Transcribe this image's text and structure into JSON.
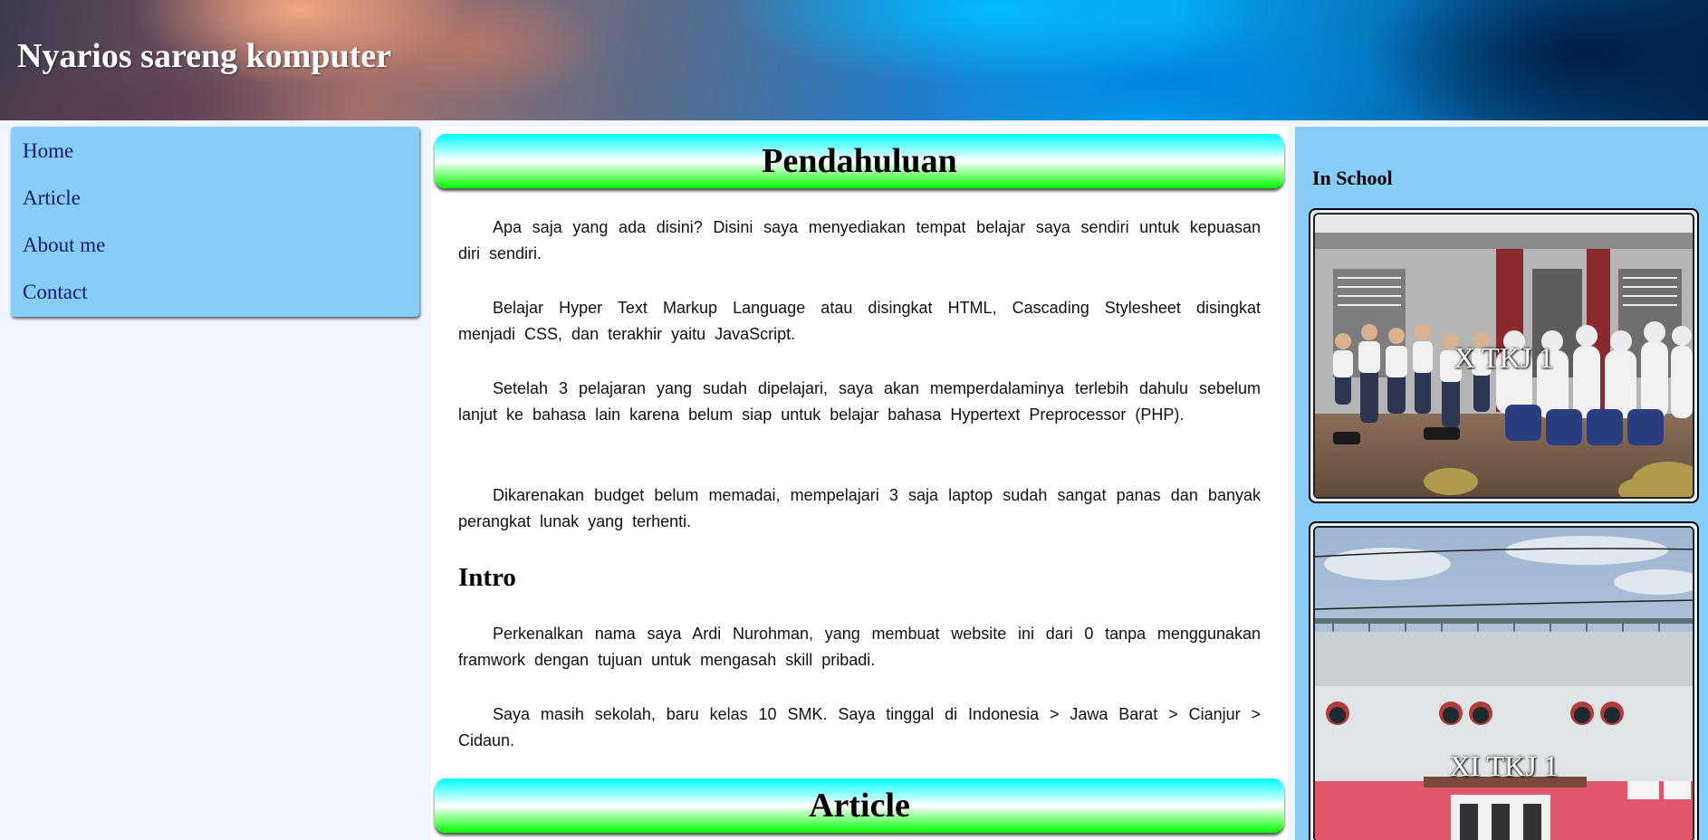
{
  "header": {
    "title": "Nyarios sareng komputer"
  },
  "nav": {
    "items": [
      {
        "label": "Home"
      },
      {
        "label": "Article"
      },
      {
        "label": "About me"
      },
      {
        "label": "Contact"
      }
    ]
  },
  "main": {
    "section1_title": "Pendahuluan",
    "paragraphs": [
      "Apa saja yang ada disini? Disini saya menyediakan tempat belajar saya sendiri untuk kepuasan diri sendiri.",
      "Belajar Hyper Text Markup Language atau disingkat HTML, Cascading Stylesheet disingkat menjadi CSS, dan terakhir yaitu JavaScript.",
      "Setelah 3 pelajaran yang sudah dipelajari, saya akan memperdalaminya terlebih dahulu sebelum lanjut ke bahasa lain karena belum siap untuk belajar bahasa Hypertext Preprocessor (PHP).",
      "Dikarenakan budget belum memadai, mempelajari 3 saja laptop sudah sangat panas dan banyak perangkat lunak yang terhenti."
    ],
    "intro_title": "Intro",
    "intro_paragraphs": [
      "Perkenalkan nama saya Ardi Nurohman, yang membuat website ini dari 0 tanpa menggunakan framwork dengan tujuan untuk mengasah skill pribadi.",
      "Saya masih sekolah, baru kelas 10 SMK. Saya tinggal di Indonesia > Jawa Barat > Cianjur > Cidaun."
    ],
    "section2_title": "Article"
  },
  "aside": {
    "title": "In School",
    "photos": [
      {
        "caption": "X TKJ 1"
      },
      {
        "caption": "XI TKJ 1"
      }
    ]
  },
  "colors": {
    "nav_bg": "#87cdf7",
    "nav_text": "#0b1a73",
    "aside_bg": "#87cdf7",
    "page_bg": "#f0f5ff",
    "banner_top": "#00ffff",
    "banner_bottom": "#00ff00"
  }
}
